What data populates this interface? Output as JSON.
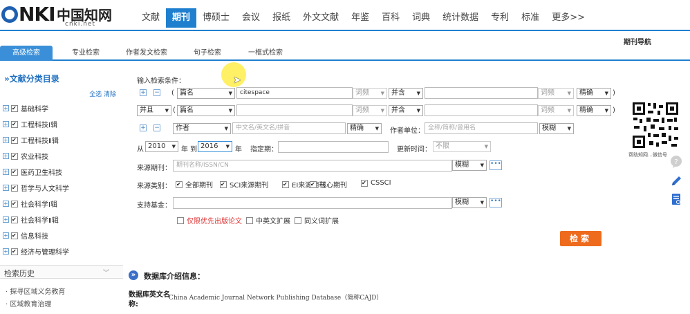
{
  "logo": {
    "brand": "CNKI",
    "name_cn": "中国知网",
    "url": "cnki.net"
  },
  "nav": [
    {
      "label": "文献",
      "active": false
    },
    {
      "label": "期刊",
      "active": true
    },
    {
      "label": "博硕士",
      "active": false
    },
    {
      "label": "会议",
      "active": false
    },
    {
      "label": "报纸",
      "active": false
    },
    {
      "label": "外文文献",
      "active": false
    },
    {
      "label": "年鉴",
      "active": false
    },
    {
      "label": "百科",
      "active": false
    },
    {
      "label": "词典",
      "active": false
    },
    {
      "label": "统计数据",
      "active": false
    },
    {
      "label": "专利",
      "active": false
    },
    {
      "label": "标准",
      "active": false
    },
    {
      "label": "更多>>",
      "active": false
    }
  ],
  "journal_nav": "期刊导航",
  "tabs": [
    {
      "label": "高级检索",
      "active": true
    },
    {
      "label": "专业检索",
      "active": false
    },
    {
      "label": "作者发文检索",
      "active": false
    },
    {
      "label": "句子检索",
      "active": false
    },
    {
      "label": "一框式检索",
      "active": false
    }
  ],
  "sidebar": {
    "title": "»文献分类目录",
    "select_all": "全选",
    "clear": "清除",
    "items": [
      "基础科学",
      "工程科技Ⅰ辑",
      "工程科技Ⅱ辑",
      "农业科技",
      "医药卫生科技",
      "哲学与人文科学",
      "社会科学Ⅰ辑",
      "社会科学Ⅱ辑",
      "信息科技",
      "经济与管理科学"
    ],
    "history_title": "检索历史",
    "history_items": [
      "· 探寻区域义务教育",
      "· 区域教育治理"
    ]
  },
  "form": {
    "input_label": "输入检索条件：",
    "row1": {
      "open": "(",
      "field": "篇名",
      "value": "citespace",
      "freq": "词频",
      "op": "并含",
      "freq2": "词频",
      "match": "精确",
      "close": ")"
    },
    "row2": {
      "logic": "并且",
      "open": "(",
      "field": "篇名",
      "freq": "词频",
      "op": "并含",
      "freq2": "词频",
      "match": "精确",
      "close": ")"
    },
    "row3": {
      "field": "作者",
      "placeholder": "中文名/英文名/拼音",
      "match": "精确",
      "unit_label": "作者单位：",
      "unit_placeholder": "全称/简称/曾用名",
      "unit_match": "模糊"
    },
    "row4": {
      "from": "从",
      "year_from": "2010",
      "year_to_label": "年 到",
      "year_to": "2016",
      "year_suffix": "年",
      "period_label": "指定期：",
      "update_label": "更新时间：",
      "update_value": "不限"
    },
    "source_label": "来源期刊：",
    "source_placeholder": "期刊名称/ISSN/CN",
    "source_match": "模糊",
    "category_label": "来源类别：",
    "categories": [
      "全部期刊",
      "SCI来源期刊",
      "EI来源期刊",
      "核心期刊",
      "CSSCI"
    ],
    "fund_label": "支持基金：",
    "fund_match": "模糊",
    "options": [
      {
        "label": "仅限优先出版论文",
        "red": true
      },
      {
        "label": "中英文扩展",
        "red": false
      },
      {
        "label": "同义词扩展",
        "red": false
      }
    ],
    "more_symbol": "•••",
    "search_button": "检索"
  },
  "dbinfo": {
    "title": "数据库介绍信息：",
    "key_line1": "数据库英文名",
    "key_line2": "称:",
    "value": "China Academic Journal Network Publishing Database（简称CAJD）"
  },
  "qr_caption": "帮助知网…微信号",
  "colors": {
    "accent": "#1f7fcf",
    "search_button": "#ee6a1c",
    "tab_active": "#3a8fd8"
  }
}
